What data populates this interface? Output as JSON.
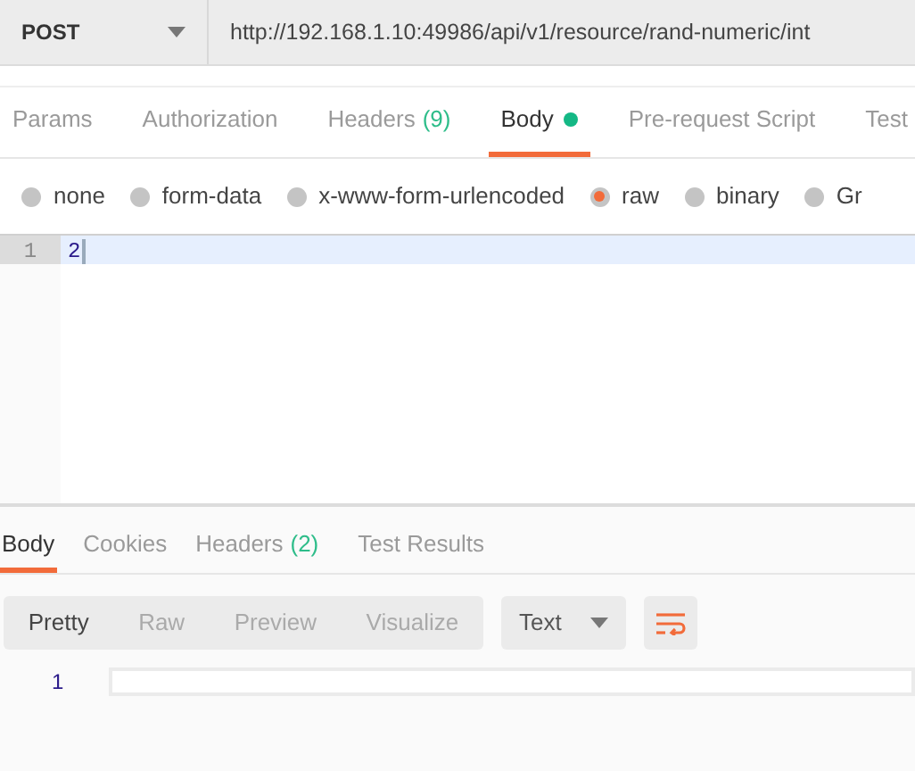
{
  "request": {
    "method": "POST",
    "url": "http://192.168.1.10:49986/api/v1/resource/rand-numeric/int"
  },
  "request_tabs": [
    {
      "label": "Params",
      "selected": false,
      "has_content": false
    },
    {
      "label": "Authorization",
      "selected": false,
      "has_content": false
    },
    {
      "label": "Headers",
      "count": "(9)",
      "selected": false,
      "has_content": false
    },
    {
      "label": "Body",
      "selected": true,
      "has_content": true
    },
    {
      "label": "Pre-request Script",
      "selected": false,
      "has_content": false
    },
    {
      "label": "Test",
      "selected": false,
      "has_content": false
    }
  ],
  "body_types": [
    {
      "label": "none",
      "selected": false
    },
    {
      "label": "form-data",
      "selected": false
    },
    {
      "label": "x-www-form-urlencoded",
      "selected": false
    },
    {
      "label": "raw",
      "selected": true
    },
    {
      "label": "binary",
      "selected": false
    },
    {
      "label": "Gr",
      "selected": false
    }
  ],
  "editor": {
    "lines": [
      {
        "number": "1",
        "text": "2",
        "current": true
      }
    ]
  },
  "response_tabs": [
    {
      "label": "Body",
      "selected": true
    },
    {
      "label": "Cookies",
      "selected": false
    },
    {
      "label": "Headers",
      "count": "(2)",
      "selected": false
    },
    {
      "label": "Test Results",
      "selected": false
    }
  ],
  "view_modes": [
    {
      "label": "Pretty",
      "selected": true
    },
    {
      "label": "Raw",
      "selected": false
    },
    {
      "label": "Preview",
      "selected": false
    },
    {
      "label": "Visualize",
      "selected": false
    }
  ],
  "format": "Text",
  "wrap_lines": true,
  "response_lines": [
    {
      "number": "1"
    }
  ]
}
